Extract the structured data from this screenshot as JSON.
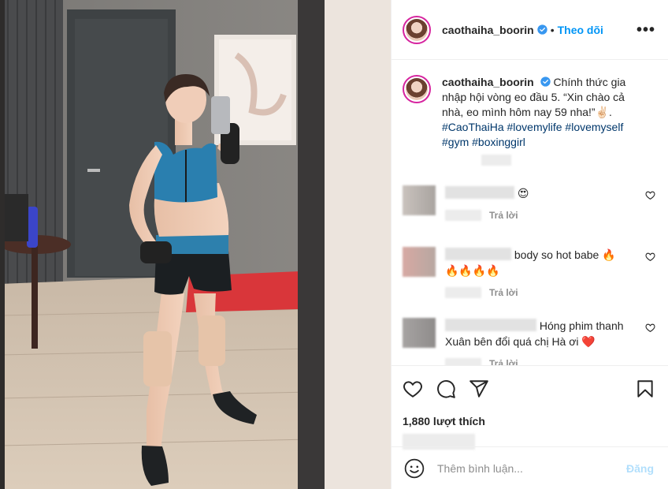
{
  "header": {
    "username": "caothaiha_boorin",
    "separator": "•",
    "follow_label": "Theo dõi",
    "more_label": "•••"
  },
  "caption": {
    "username": "caothaiha_boorin",
    "text": "Chính thức gia nhập hội vòng eo đầu 5. “Xin chào cả nhà, eo mình hôm nay 59 nha!”✌🏻.",
    "hashtags": [
      "#CaoThaiHa",
      "#lovemylife",
      "#lovemyself",
      "#gym",
      "#boxinggirl"
    ]
  },
  "comments": [
    {
      "text": "😍",
      "reply_label": "Trả lời"
    },
    {
      "text": "body so hot babe 🔥",
      "text2": "🔥🔥🔥🔥",
      "reply_label": "Trả lời"
    },
    {
      "text": "Hóng phim thanh",
      "text2": "Xuân bên đổi quá chị Hà ơi ❤️",
      "reply_label": "Trả lời"
    }
  ],
  "likes": {
    "text": "1,880 lượt thích"
  },
  "composer": {
    "placeholder": "Thêm bình luận...",
    "post_label": "Đăng"
  },
  "icons": [
    "verified-badge-icon",
    "heart-icon",
    "comment-icon",
    "share-icon",
    "bookmark-icon",
    "emoji-icon",
    "more-options-icon"
  ],
  "colors": {
    "accent": "#0095f6",
    "hashtag": "#00376b",
    "muted": "#8e8e8e",
    "post_disabled": "#b2dffc",
    "border": "#efefef"
  }
}
